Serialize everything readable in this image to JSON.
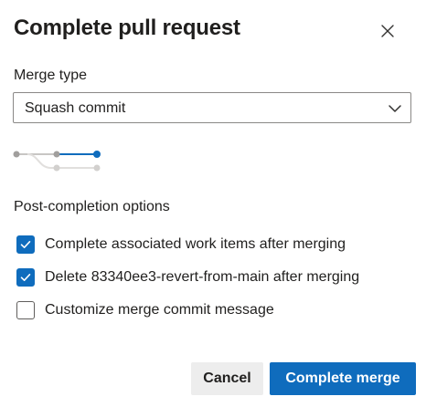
{
  "dialog": {
    "title": "Complete pull request",
    "close_icon": "close-icon"
  },
  "merge": {
    "label": "Merge type",
    "selected": "Squash commit",
    "chevron_icon": "chevron-down-icon"
  },
  "diagram": {
    "icon": "squash-merge-diagram-icon",
    "accent_color": "#0f6cbd"
  },
  "post_completion": {
    "label": "Post-completion options",
    "options": [
      {
        "label": "Complete associated work items after merging",
        "checked": true
      },
      {
        "label": "Delete 83340ee3-revert-from-main after merging",
        "checked": true
      },
      {
        "label": "Customize merge commit message",
        "checked": false
      }
    ]
  },
  "buttons": {
    "cancel": "Cancel",
    "complete": "Complete merge"
  },
  "colors": {
    "primary": "#0f6cbd",
    "text": "#201f1e",
    "cancel_bg": "#ededed"
  }
}
